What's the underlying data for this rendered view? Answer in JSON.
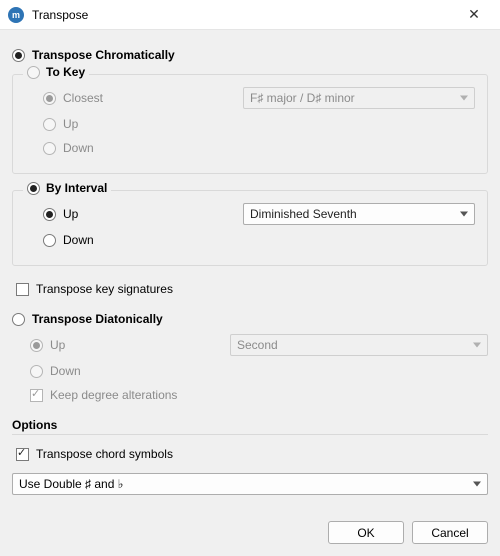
{
  "window": {
    "title": "Transpose"
  },
  "chromatic": {
    "title": "Transpose Chromatically",
    "selected": true,
    "toKey": {
      "title": "To Key",
      "selected": false,
      "closest": "Closest",
      "up": "Up",
      "down": "Down",
      "combo_value": "F♯ major / D♯ minor"
    },
    "byInterval": {
      "title": "By Interval",
      "selected": true,
      "up": "Up",
      "down": "Down",
      "combo_value": "Diminished Seventh"
    },
    "transposeKeySigs": {
      "label": "Transpose key signatures",
      "checked": false
    }
  },
  "diatonic": {
    "title": "Transpose Diatonically",
    "selected": false,
    "up": "Up",
    "down": "Down",
    "combo_value": "Second",
    "keepDegree": {
      "label": "Keep degree alterations",
      "checked": true
    }
  },
  "options": {
    "title": "Options",
    "chordSymbols": {
      "label": "Transpose chord symbols",
      "checked": true
    },
    "accidentals": "Use Double ♯ and ♭"
  },
  "buttons": {
    "ok": "OK",
    "cancel": "Cancel"
  }
}
